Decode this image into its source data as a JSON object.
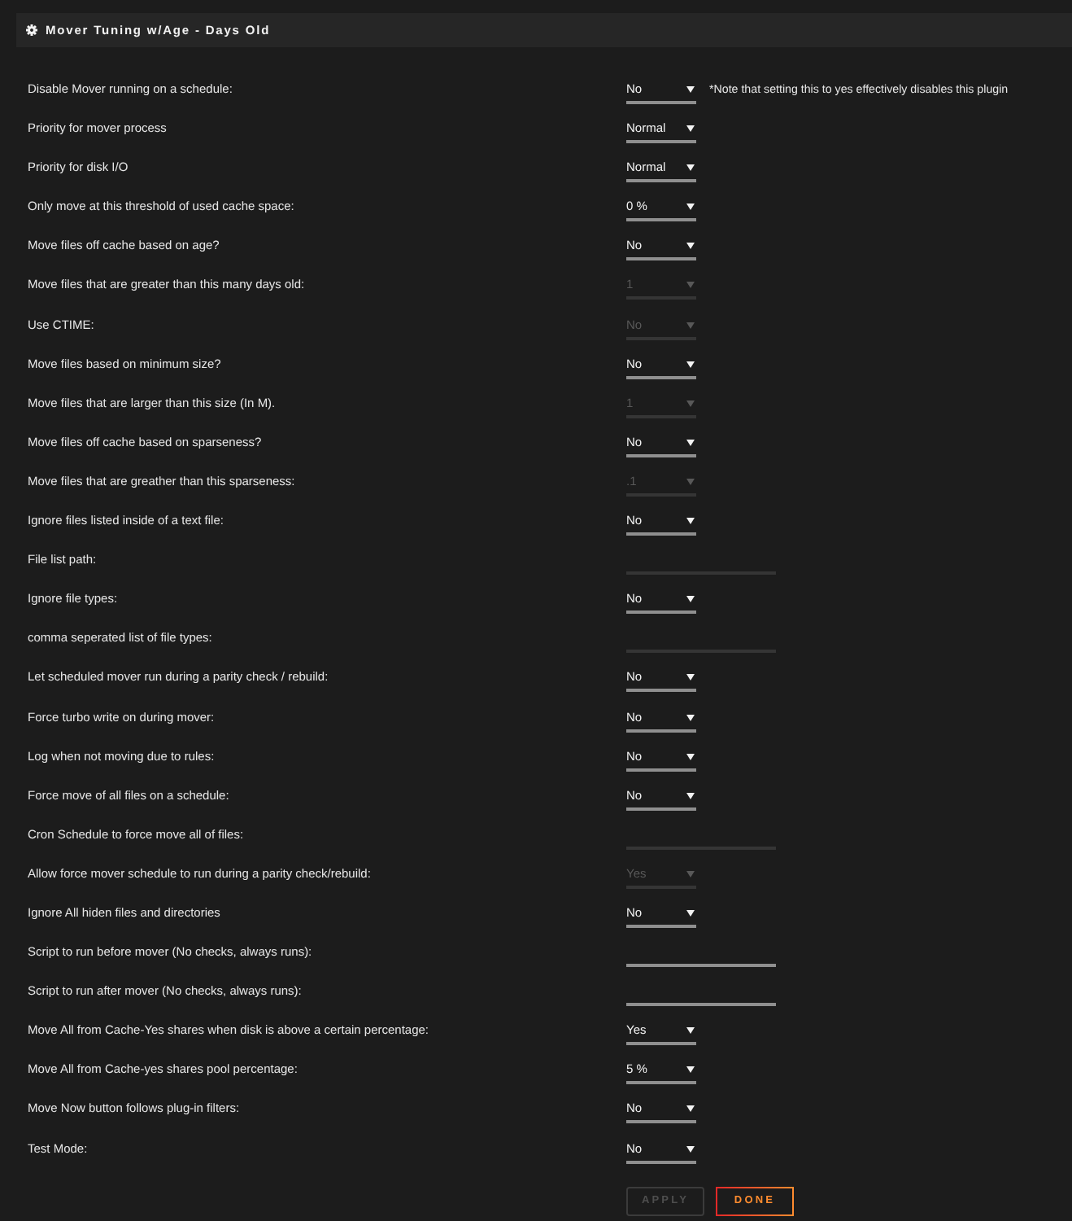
{
  "panel": {
    "title": "Mover Tuning w/Age - Days Old"
  },
  "settings": [
    {
      "label": "Disable Mover running on a schedule:",
      "kind": "select",
      "value": "No",
      "disabled": false,
      "note": "*Note that setting this to yes effectively disables this plugin"
    },
    {
      "label": "Priority for mover process",
      "kind": "select",
      "value": "Normal",
      "disabled": false
    },
    {
      "label": "Priority for disk I/O",
      "kind": "select",
      "value": "Normal",
      "disabled": false
    },
    {
      "label": "Only move at this threshold of used cache space:",
      "kind": "select",
      "value": "0 %",
      "disabled": false
    },
    {
      "label": "Move files off cache based on age?",
      "kind": "select",
      "value": "No",
      "disabled": false
    },
    {
      "label": "Move files that are greater than this many days old:",
      "kind": "select",
      "value": "1",
      "disabled": true
    },
    {
      "label": "Use CTIME:",
      "kind": "select",
      "value": "No",
      "disabled": true
    },
    {
      "label": "Move files based on minimum size?",
      "kind": "select",
      "value": "No",
      "disabled": false
    },
    {
      "label": "Move files that are larger than this size (In M).",
      "kind": "select",
      "value": "1",
      "disabled": true
    },
    {
      "label": "Move files off cache based on sparseness?",
      "kind": "select",
      "value": "No",
      "disabled": false
    },
    {
      "label": "Move files that are greather than this sparseness:",
      "kind": "select",
      "value": ".1",
      "disabled": true
    },
    {
      "label": "Ignore files listed inside of a text file:",
      "kind": "select",
      "value": "No",
      "disabled": false
    },
    {
      "label": "File list path:",
      "kind": "text",
      "disabled": true
    },
    {
      "label": "Ignore file types:",
      "kind": "select",
      "value": "No",
      "disabled": false
    },
    {
      "label": "comma seperated list of file types:",
      "kind": "text",
      "disabled": true
    },
    {
      "label": "Let scheduled mover run during a parity check / rebuild:",
      "kind": "select",
      "value": "No",
      "disabled": false
    },
    {
      "label": "Force turbo write on during mover:",
      "kind": "select",
      "value": "No",
      "disabled": false
    },
    {
      "label": "Log when not moving due to rules:",
      "kind": "select",
      "value": "No",
      "disabled": false
    },
    {
      "label": "Force move of all files on a schedule:",
      "kind": "select",
      "value": "No",
      "disabled": false
    },
    {
      "label": "Cron Schedule to force move all of files:",
      "kind": "text",
      "disabled": true
    },
    {
      "label": "Allow force mover schedule to run during a parity check/rebuild:",
      "kind": "select",
      "value": "Yes",
      "disabled": true
    },
    {
      "label": "Ignore All hiden files and directories",
      "kind": "select",
      "value": "No",
      "disabled": false
    },
    {
      "label": "Script to run before mover (No checks, always runs):",
      "kind": "text",
      "disabled": false
    },
    {
      "label": "Script to run after mover (No checks, always runs):",
      "kind": "text",
      "disabled": false
    },
    {
      "label": "Move All from Cache-Yes shares when disk is above a certain percentage:",
      "kind": "select",
      "value": "Yes",
      "disabled": false
    },
    {
      "label": "Move All from Cache-yes shares pool percentage:",
      "kind": "select",
      "value": "5 %",
      "disabled": false
    },
    {
      "label": "Move Now button follows plug-in filters:",
      "kind": "select",
      "value": "No",
      "disabled": false
    },
    {
      "label": "Test Mode:",
      "kind": "select",
      "value": "No",
      "disabled": false
    }
  ],
  "buttons": [
    {
      "label": "APPLY",
      "disabled": true
    },
    {
      "label": "DONE",
      "disabled": false
    }
  ]
}
